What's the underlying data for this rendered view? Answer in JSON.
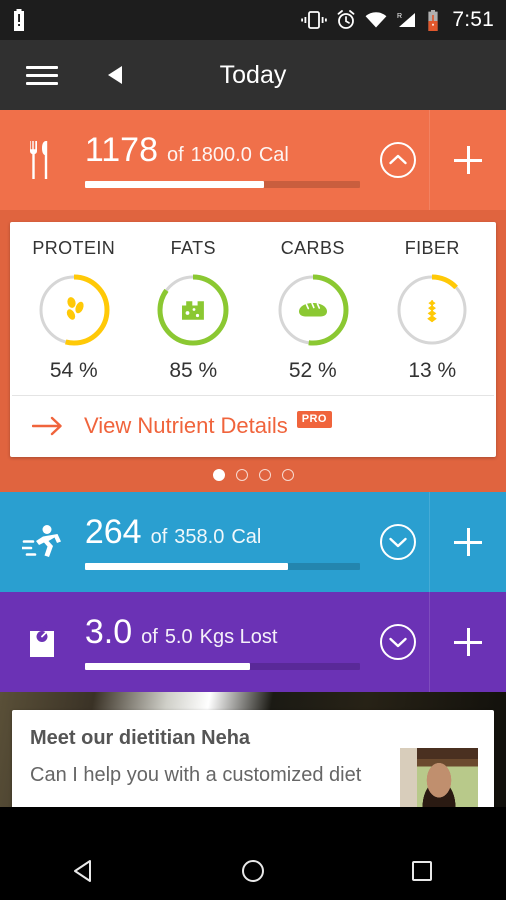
{
  "statusbar": {
    "time": "7:51",
    "icons": [
      "battery-alert-icon",
      "vibrate-icon",
      "alarm-icon",
      "wifi-icon",
      "signal-roaming-icon",
      "battery-low-icon"
    ]
  },
  "appbar": {
    "title": "Today",
    "menu_icon": "hamburger-menu-icon",
    "back_icon": "back-triangle-icon"
  },
  "calories": {
    "icon": "fork-knife-icon",
    "current": "1178",
    "of": "of",
    "goal": "1800.0",
    "unit": "Cal",
    "progress_pct": 65,
    "collapse_icon": "chevron-up-circle-icon",
    "add_icon": "plus-icon",
    "color": "#f0704a"
  },
  "nutrients": {
    "items": [
      {
        "label": "PROTEIN",
        "percent": "54 %",
        "value": 54,
        "color": "#ffc907",
        "icon": "beans-icon"
      },
      {
        "label": "FATS",
        "percent": "85 %",
        "value": 85,
        "color": "#8bc832",
        "icon": "cheese-icon"
      },
      {
        "label": "CARBS",
        "percent": "52 %",
        "value": 52,
        "color": "#8bc832",
        "icon": "bread-icon"
      },
      {
        "label": "FIBER",
        "percent": "13 %",
        "value": 13,
        "color": "#ffc907",
        "icon": "wheat-icon"
      }
    ],
    "link_label": "View Nutrient Details",
    "link_badge": "PRO",
    "link_arrow_icon": "arrow-right-icon",
    "pager": {
      "total": 4,
      "active": 1
    }
  },
  "exercise": {
    "icon": "runner-icon",
    "current": "264",
    "of": "of",
    "goal": "358.0",
    "unit": "Cal",
    "progress_pct": 74,
    "expand_icon": "chevron-down-circle-icon",
    "add_icon": "plus-icon",
    "color": "#2a9fd0"
  },
  "weight": {
    "icon": "weighing-scale-icon",
    "current": "3.0",
    "of": "of",
    "goal": "5.0",
    "unit": "Kgs Lost",
    "progress_pct": 60,
    "expand_icon": "chevron-down-circle-icon",
    "add_icon": "plus-icon",
    "color": "#6b32b5"
  },
  "dietitian": {
    "title": "Meet our dietitian Neha",
    "subtitle": "Can I help you with a customized diet",
    "photo": "dietitian-photo"
  },
  "navbar": {
    "back": "nav-back-icon",
    "home": "nav-home-icon",
    "recents": "nav-recents-icon"
  }
}
